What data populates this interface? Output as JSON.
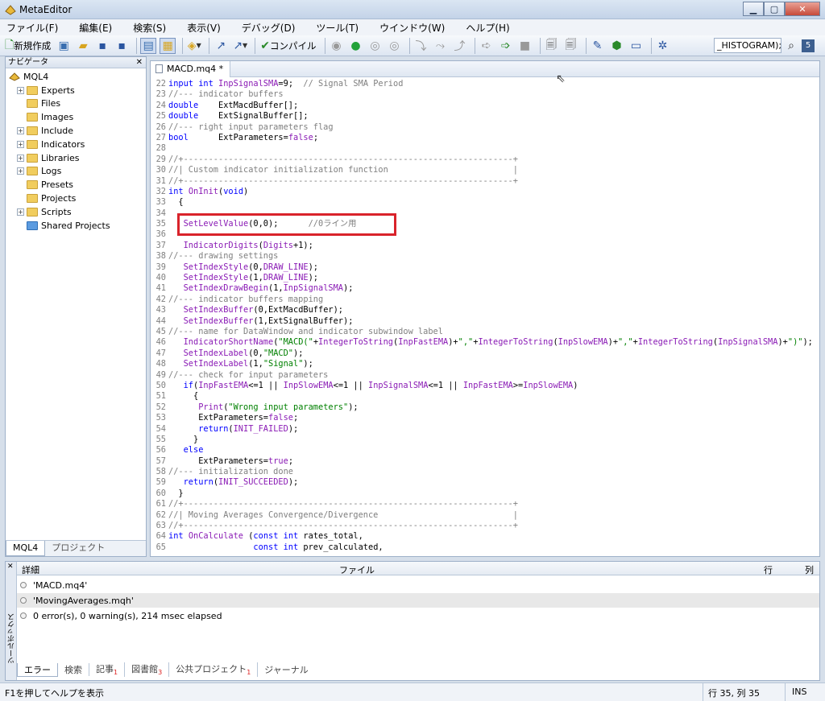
{
  "window": {
    "title": "MetaEditor",
    "min": "▁",
    "max": "▢",
    "close": "✕"
  },
  "menu": [
    "ファイル(F)",
    "編集(E)",
    "検索(S)",
    "表示(V)",
    "デバッグ(D)",
    "ツール(T)",
    "ウインドウ(W)",
    "ヘルプ(H)"
  ],
  "toolbar": {
    "new_label": "新規作成",
    "compile_label": "コンパイル",
    "search_value": "_HISTOGRAM);",
    "badge": "5"
  },
  "navigator": {
    "title": "ナビゲータ",
    "close": "✕",
    "root": "MQL4",
    "items": [
      "Experts",
      "Files",
      "Images",
      "Include",
      "Indicators",
      "Libraries",
      "Logs",
      "Presets",
      "Projects",
      "Scripts",
      "Shared Projects"
    ],
    "tabs": [
      "MQL4",
      "プロジェクト"
    ]
  },
  "editor": {
    "tab_label": "MACD.mq4 *",
    "lines": [
      {
        "n": "22",
        "t": "input int InpSignalSMA=9;  // Signal SMA Period"
      },
      {
        "n": "23",
        "t": "//--- indicator buffers"
      },
      {
        "n": "24",
        "t": "double    ExtMacdBuffer[];"
      },
      {
        "n": "25",
        "t": "double    ExtSignalBuffer[];"
      },
      {
        "n": "26",
        "t": "//--- right input parameters flag"
      },
      {
        "n": "27",
        "t": "bool      ExtParameters=false;"
      },
      {
        "n": "28",
        "t": ""
      },
      {
        "n": "29",
        "t": "//+------------------------------------------------------------------+"
      },
      {
        "n": "30",
        "t": "//| Custom indicator initialization function                         |"
      },
      {
        "n": "31",
        "t": "//+------------------------------------------------------------------+"
      },
      {
        "n": "32",
        "t": "int OnInit(void)"
      },
      {
        "n": "33",
        "t": "  {"
      },
      {
        "n": "34",
        "t": ""
      },
      {
        "n": "35",
        "t": "   SetLevelValue(0,0);      //0ライン用"
      },
      {
        "n": "36",
        "t": ""
      },
      {
        "n": "37",
        "t": "   IndicatorDigits(Digits+1);"
      },
      {
        "n": "38",
        "t": "//--- drawing settings"
      },
      {
        "n": "39",
        "t": "   SetIndexStyle(0,DRAW_LINE);"
      },
      {
        "n": "40",
        "t": "   SetIndexStyle(1,DRAW_LINE);"
      },
      {
        "n": "41",
        "t": "   SetIndexDrawBegin(1,InpSignalSMA);"
      },
      {
        "n": "42",
        "t": "//--- indicator buffers mapping"
      },
      {
        "n": "43",
        "t": "   SetIndexBuffer(0,ExtMacdBuffer);"
      },
      {
        "n": "44",
        "t": "   SetIndexBuffer(1,ExtSignalBuffer);"
      },
      {
        "n": "45",
        "t": "//--- name for DataWindow and indicator subwindow label"
      },
      {
        "n": "46",
        "t": "   IndicatorShortName(\"MACD(\"+IntegerToString(InpFastEMA)+\",\"+IntegerToString(InpSlowEMA)+\",\"+IntegerToString(InpSignalSMA)+\")\");"
      },
      {
        "n": "47",
        "t": "   SetIndexLabel(0,\"MACD\");"
      },
      {
        "n": "48",
        "t": "   SetIndexLabel(1,\"Signal\");"
      },
      {
        "n": "49",
        "t": "//--- check for input parameters"
      },
      {
        "n": "50",
        "t": "   if(InpFastEMA<=1 || InpSlowEMA<=1 || InpSignalSMA<=1 || InpFastEMA>=InpSlowEMA)"
      },
      {
        "n": "51",
        "t": "     {"
      },
      {
        "n": "52",
        "t": "      Print(\"Wrong input parameters\");"
      },
      {
        "n": "53",
        "t": "      ExtParameters=false;"
      },
      {
        "n": "54",
        "t": "      return(INIT_FAILED);"
      },
      {
        "n": "55",
        "t": "     }"
      },
      {
        "n": "56",
        "t": "   else"
      },
      {
        "n": "57",
        "t": "      ExtParameters=true;"
      },
      {
        "n": "58",
        "t": "//--- initialization done"
      },
      {
        "n": "59",
        "t": "   return(INIT_SUCCEEDED);"
      },
      {
        "n": "60",
        "t": "  }"
      },
      {
        "n": "61",
        "t": "//+------------------------------------------------------------------+"
      },
      {
        "n": "62",
        "t": "//| Moving Averages Convergence/Divergence                           |"
      },
      {
        "n": "63",
        "t": "//+------------------------------------------------------------------+"
      },
      {
        "n": "64",
        "t": "int OnCalculate (const int rates_total,"
      },
      {
        "n": "65",
        "t": "                 const int prev_calculated,"
      }
    ]
  },
  "toolbox": {
    "side_close": "✕",
    "side_label": "ツールボックス",
    "columns": {
      "detail": "詳細",
      "file": "ファイル",
      "row": "行",
      "col": "列"
    },
    "messages": [
      "'MACD.mq4'",
      "'MovingAverages.mqh'",
      "0 error(s), 0 warning(s), 214 msec elapsed"
    ],
    "tabs": [
      {
        "label": "エラー",
        "count": ""
      },
      {
        "label": "検索",
        "count": ""
      },
      {
        "label": "記事",
        "count": "1"
      },
      {
        "label": "図書館",
        "count": "3"
      },
      {
        "label": "公共プロジェクト",
        "count": "1"
      },
      {
        "label": "ジャーナル",
        "count": ""
      }
    ]
  },
  "status": {
    "help": "F1を押してヘルプを表示",
    "position": "行 35, 列 35",
    "mode": "INS"
  }
}
